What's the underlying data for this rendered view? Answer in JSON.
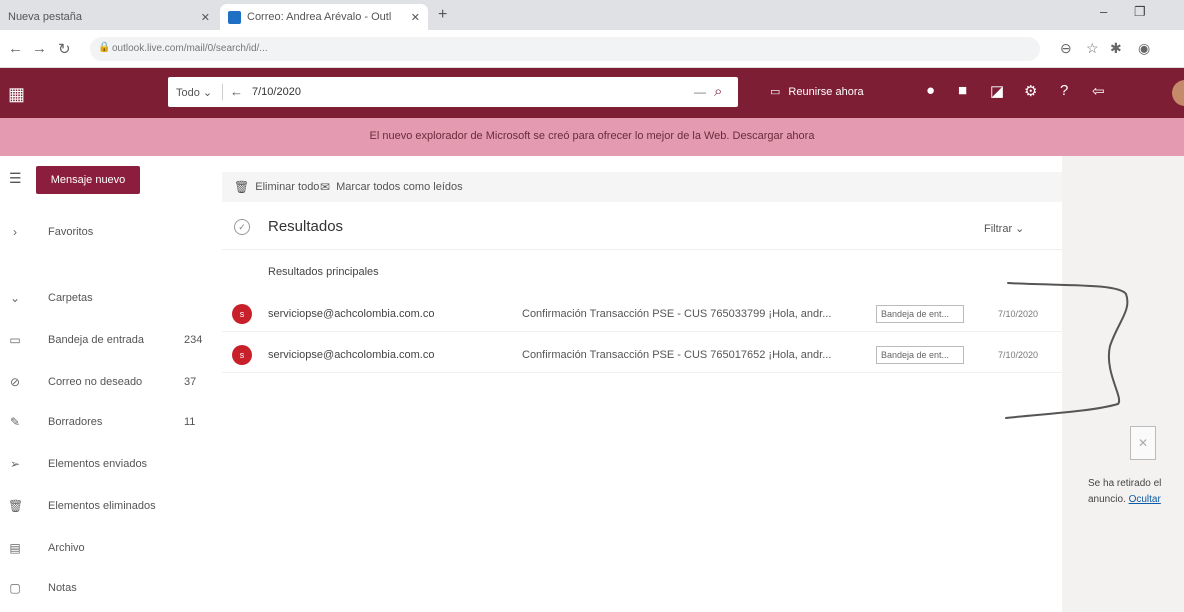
{
  "browser": {
    "tabs": [
      {
        "title": "Nueva pestaña",
        "active": false
      },
      {
        "title": "Correo: Andrea Arévalo - Outl",
        "active": true
      }
    ],
    "url": "outlook.live.com/mail/0/search/id/..."
  },
  "header": {
    "search_scope": "Todo",
    "search_query": "7/10/2020",
    "meet_now_label": "Reunirse ahora"
  },
  "banner": {
    "text": "El nuevo explorador de Microsoft se creó para ofrecer lo mejor de la Web. Descargar ahora"
  },
  "nav": {
    "new_message_label": "Mensaje nuevo",
    "items": [
      {
        "label": "Favoritos",
        "icon": "chevron-right-icon",
        "count": ""
      },
      {
        "label": "Carpetas",
        "icon": "chevron-down-icon",
        "count": ""
      },
      {
        "label": "Bandeja de entrada",
        "icon": "inbox-icon",
        "count": "234"
      },
      {
        "label": "Correo no deseado",
        "icon": "junk-icon",
        "count": "37"
      },
      {
        "label": "Borradores",
        "icon": "pencil-icon",
        "count": "11"
      },
      {
        "label": "Elementos enviados",
        "icon": "send-icon",
        "count": ""
      },
      {
        "label": "Elementos eliminados",
        "icon": "trash-icon",
        "count": ""
      },
      {
        "label": "Archivo",
        "icon": "archive-icon",
        "count": ""
      },
      {
        "label": "Notas",
        "icon": "notes-icon",
        "count": ""
      }
    ]
  },
  "commands": {
    "delete_all": "Eliminar todo",
    "mark_all_read": "Marcar todos como leídos"
  },
  "results": {
    "title": "Resultados",
    "filter_label": "Filtrar",
    "section_label": "Resultados principales",
    "rows": [
      {
        "initial": "s",
        "sender": "serviciopse@achcolombia.com.co",
        "subject": "Confirmación Transacción PSE - CUS 765033799 ¡Hola, andr...",
        "folder": "Bandeja de ent...",
        "date": "7/10/2020"
      },
      {
        "initial": "s",
        "sender": "serviciopse@achcolombia.com.co",
        "subject": "Confirmación Transacción PSE - CUS 765017652 ¡Hola, andr...",
        "folder": "Bandeja de ent...",
        "date": "7/10/2020"
      }
    ]
  },
  "right_pane": {
    "text": "Se ha retirado el",
    "link_prefix": "anuncio.",
    "link": "Ocultar"
  },
  "colors": {
    "header": "#7e1e34",
    "banner": "#e49bb1",
    "new_message": "#8b1e3f",
    "avatar": "#c8202b"
  }
}
